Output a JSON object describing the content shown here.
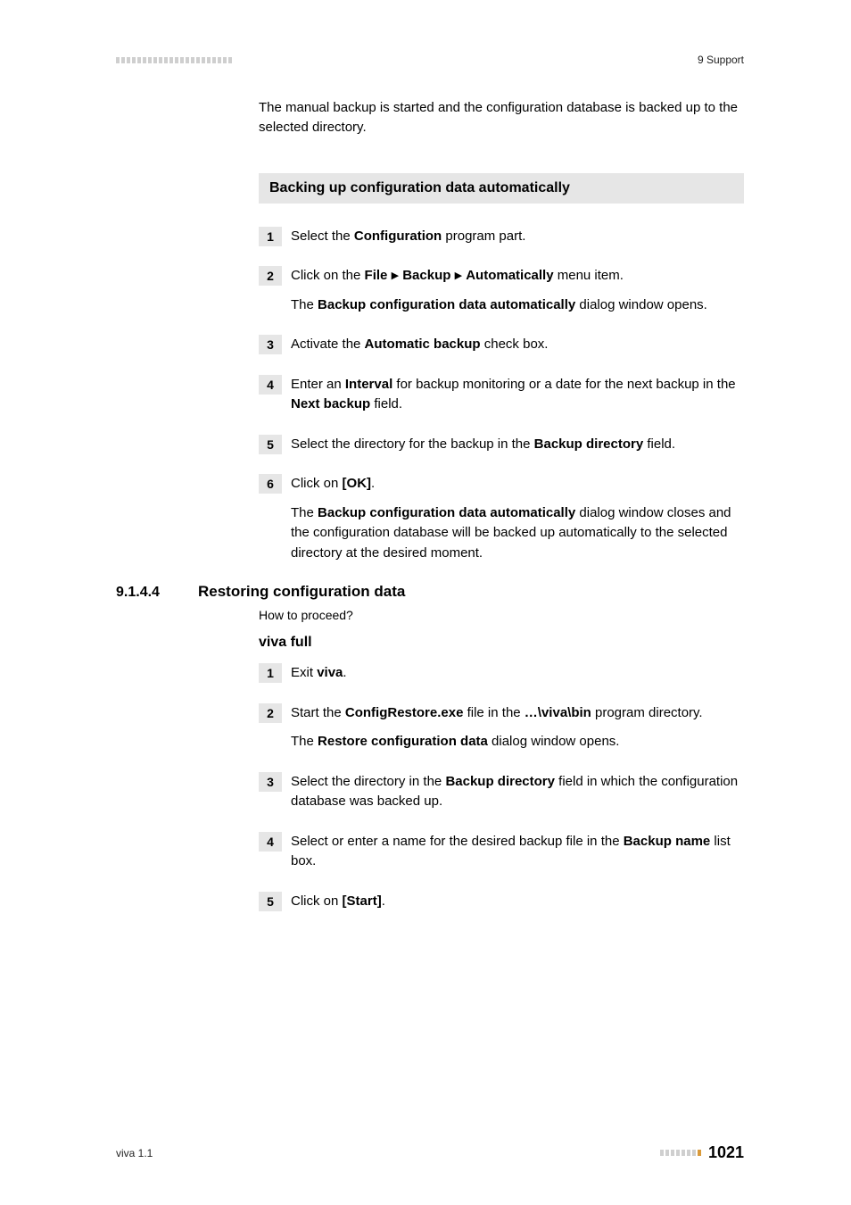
{
  "header": {
    "section_label": "9 Support"
  },
  "intro": "The manual backup is started and the configuration database is backed up to the selected directory.",
  "section_bar": "Backing up configuration data automatically",
  "steps1": [
    {
      "num": "1",
      "paras": [
        "Select the <b>Configuration</b> program part."
      ]
    },
    {
      "num": "2",
      "paras": [
        "Click on the <b>File</b> <span class='tri'>▶</span> <b>Backup</b> <span class='tri'>▶</span> <b>Automatically</b> menu item.",
        "The <b>Backup configuration data automatically</b> dialog window opens."
      ]
    },
    {
      "num": "3",
      "paras": [
        "Activate the <b>Automatic backup</b> check box."
      ]
    },
    {
      "num": "4",
      "paras": [
        "Enter an <b>Interval</b> for backup monitoring or a date for the next backup in the <b>Next backup</b> field."
      ]
    },
    {
      "num": "5",
      "paras": [
        "Select the directory for the backup in the <b>Backup directory</b> field."
      ]
    },
    {
      "num": "6",
      "paras": [
        "Click on <b>[OK]</b>.",
        "The <b>Backup configuration data automatically</b> dialog window closes and the configuration database will be backed up automatically to the selected directory at the desired moment."
      ]
    }
  ],
  "subsection": {
    "num": "9.1.4.4",
    "title": "Restoring configuration data",
    "howto": "How to proceed?",
    "viva_full": "viva full"
  },
  "steps2": [
    {
      "num": "1",
      "paras": [
        "Exit <b>viva</b>."
      ]
    },
    {
      "num": "2",
      "paras": [
        "Start the <b>ConfigRestore.exe</b> file in the <b>…\\viva\\bin</b> program directory.",
        "The <b>Restore configuration data</b> dialog window opens."
      ]
    },
    {
      "num": "3",
      "paras": [
        "Select the directory in the <b>Backup directory</b> field in which the configuration database was backed up."
      ]
    },
    {
      "num": "4",
      "paras": [
        "Select or enter a name for the desired backup file in the <b>Backup name</b> list box."
      ]
    },
    {
      "num": "5",
      "paras": [
        "Click on <b>[Start]</b>."
      ]
    }
  ],
  "footer": {
    "left": "viva 1.1",
    "page": "1021"
  }
}
